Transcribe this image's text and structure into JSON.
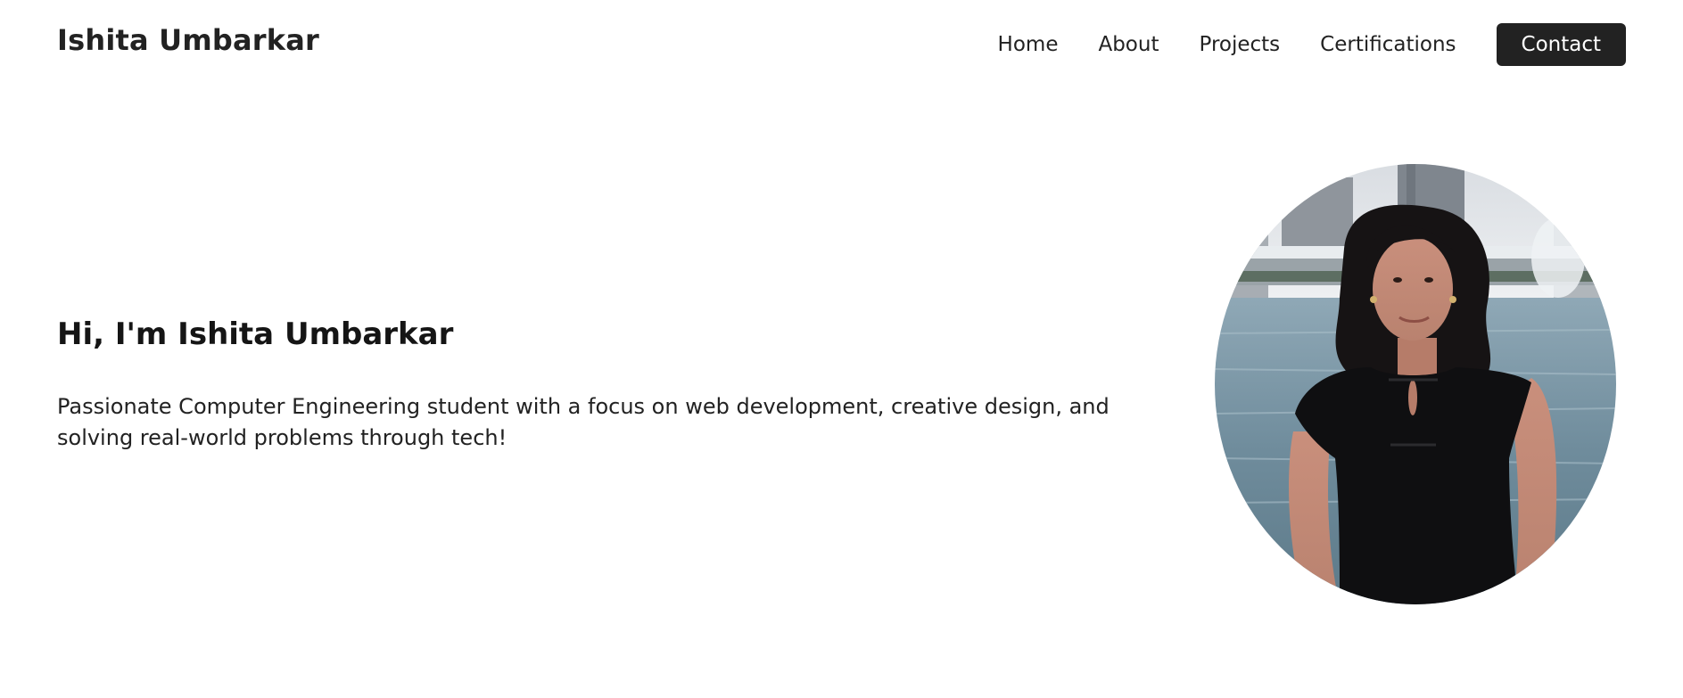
{
  "header": {
    "brand": "Ishita Umbarkar",
    "nav": [
      {
        "label": "Home"
      },
      {
        "label": "About"
      },
      {
        "label": "Projects"
      },
      {
        "label": "Certifications"
      }
    ],
    "contact_label": "Contact"
  },
  "hero": {
    "title": "Hi, I'm Ishita Umbarkar",
    "description": "Passionate Computer Engineering student with a focus on web development, creative design, and solving real-world problems through tech!"
  },
  "colors": {
    "text": "#222222",
    "button_bg": "#222222",
    "button_text": "#ffffff",
    "background": "#ffffff"
  }
}
